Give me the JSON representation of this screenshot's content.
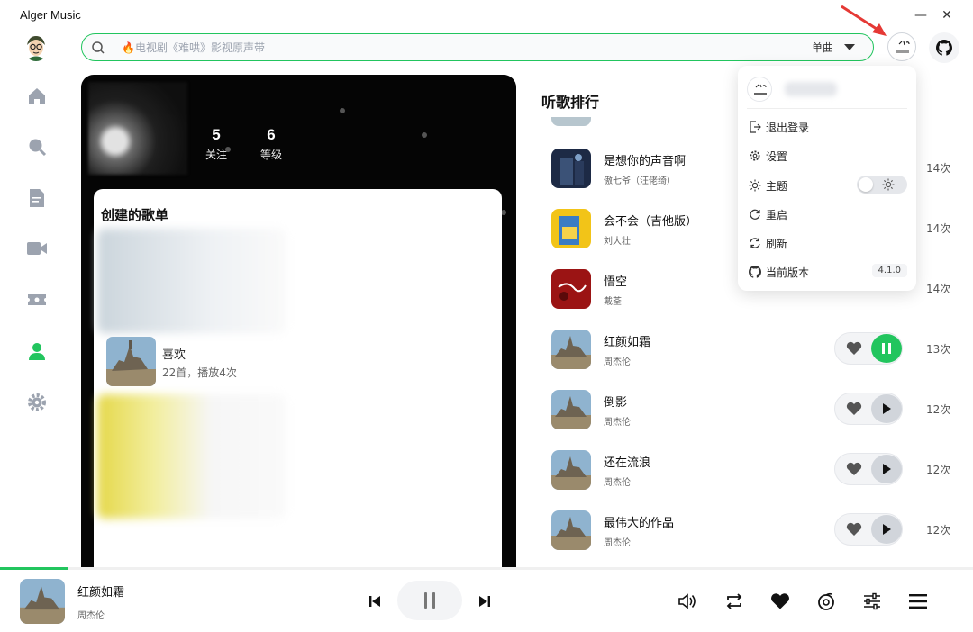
{
  "app": {
    "title": "Alger Music"
  },
  "search": {
    "placeholder": "🔥电视剧《难哄》影视原声带",
    "type_label": "单曲"
  },
  "profile": {
    "stats": [
      {
        "value": "5",
        "label": "关注"
      },
      {
        "value": "6",
        "label": "等级"
      }
    ]
  },
  "playlists": {
    "title": "创建的歌单",
    "liked": {
      "name": "喜欢",
      "meta": "22首，播放4次"
    }
  },
  "ranking": {
    "title": "听歌排行",
    "songs": [
      {
        "name": "是想你的声音啊",
        "artist": "傲七爷（汪佬绮）",
        "count": "14次",
        "playing": false
      },
      {
        "name": "会不会（吉他版）",
        "artist": "刘大壮",
        "count": "14次",
        "playing": false
      },
      {
        "name": "悟空",
        "artist": "戴荃",
        "count": "14次",
        "playing": false
      },
      {
        "name": "红颜如霜",
        "artist": "周杰伦",
        "count": "13次",
        "playing": true
      },
      {
        "name": "倒影",
        "artist": "周杰伦",
        "count": "12次",
        "playing": false
      },
      {
        "name": "还在流浪",
        "artist": "周杰伦",
        "count": "12次",
        "playing": false
      },
      {
        "name": "最伟大的作品",
        "artist": "周杰伦",
        "count": "12次",
        "playing": false
      }
    ]
  },
  "user_menu": {
    "items": [
      {
        "label": "退出登录",
        "icon": "logout-icon"
      },
      {
        "label": "设置",
        "icon": "gear-icon"
      },
      {
        "label": "主题",
        "icon": "sun-icon"
      },
      {
        "label": "重启",
        "icon": "restart-icon"
      },
      {
        "label": "刷新",
        "icon": "refresh-icon"
      },
      {
        "label": "当前版本",
        "icon": "github-icon"
      }
    ],
    "version": "4.1.0",
    "theme_dark": false
  },
  "player": {
    "title": "红颜如霜",
    "artist": "周杰伦",
    "progress_fraction": 0.07
  },
  "colors": {
    "accent": "#22c55e",
    "panel": "#050505"
  }
}
